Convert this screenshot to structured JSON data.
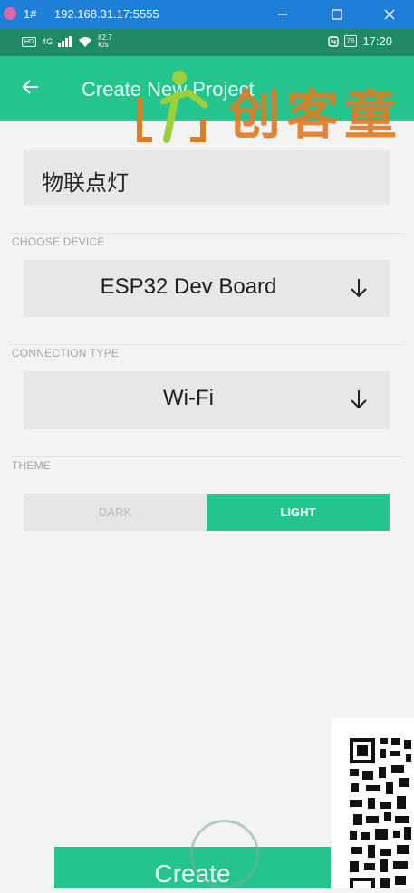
{
  "window": {
    "index": "1#",
    "address": "192.168.31.17:5555"
  },
  "status_bar": {
    "hd": "HD",
    "network": "4G",
    "speed": "82.7",
    "speed_unit": "K/s",
    "battery": "76",
    "time": "17:20"
  },
  "app_bar": {
    "title": "Create New Project"
  },
  "watermark": {
    "text": "创客童"
  },
  "project_name": {
    "value": "物联点灯"
  },
  "device": {
    "section_label": "CHOOSE DEVICE",
    "value": "ESP32 Dev Board"
  },
  "connection": {
    "section_label": "CONNECTION TYPE",
    "value": "Wi-Fi"
  },
  "theme": {
    "section_label": "THEME",
    "options": [
      "DARK",
      "LIGHT"
    ],
    "selected": "LIGHT"
  },
  "create_button": {
    "label": "Create"
  },
  "colors": {
    "accent": "#23c48e",
    "status_bar": "#1f8a63",
    "window_bar": "#1e7fd9",
    "watermark": "#e27a24"
  },
  "icons": {
    "back": "arrow-left-icon",
    "dropdown": "arrow-down-icon"
  }
}
